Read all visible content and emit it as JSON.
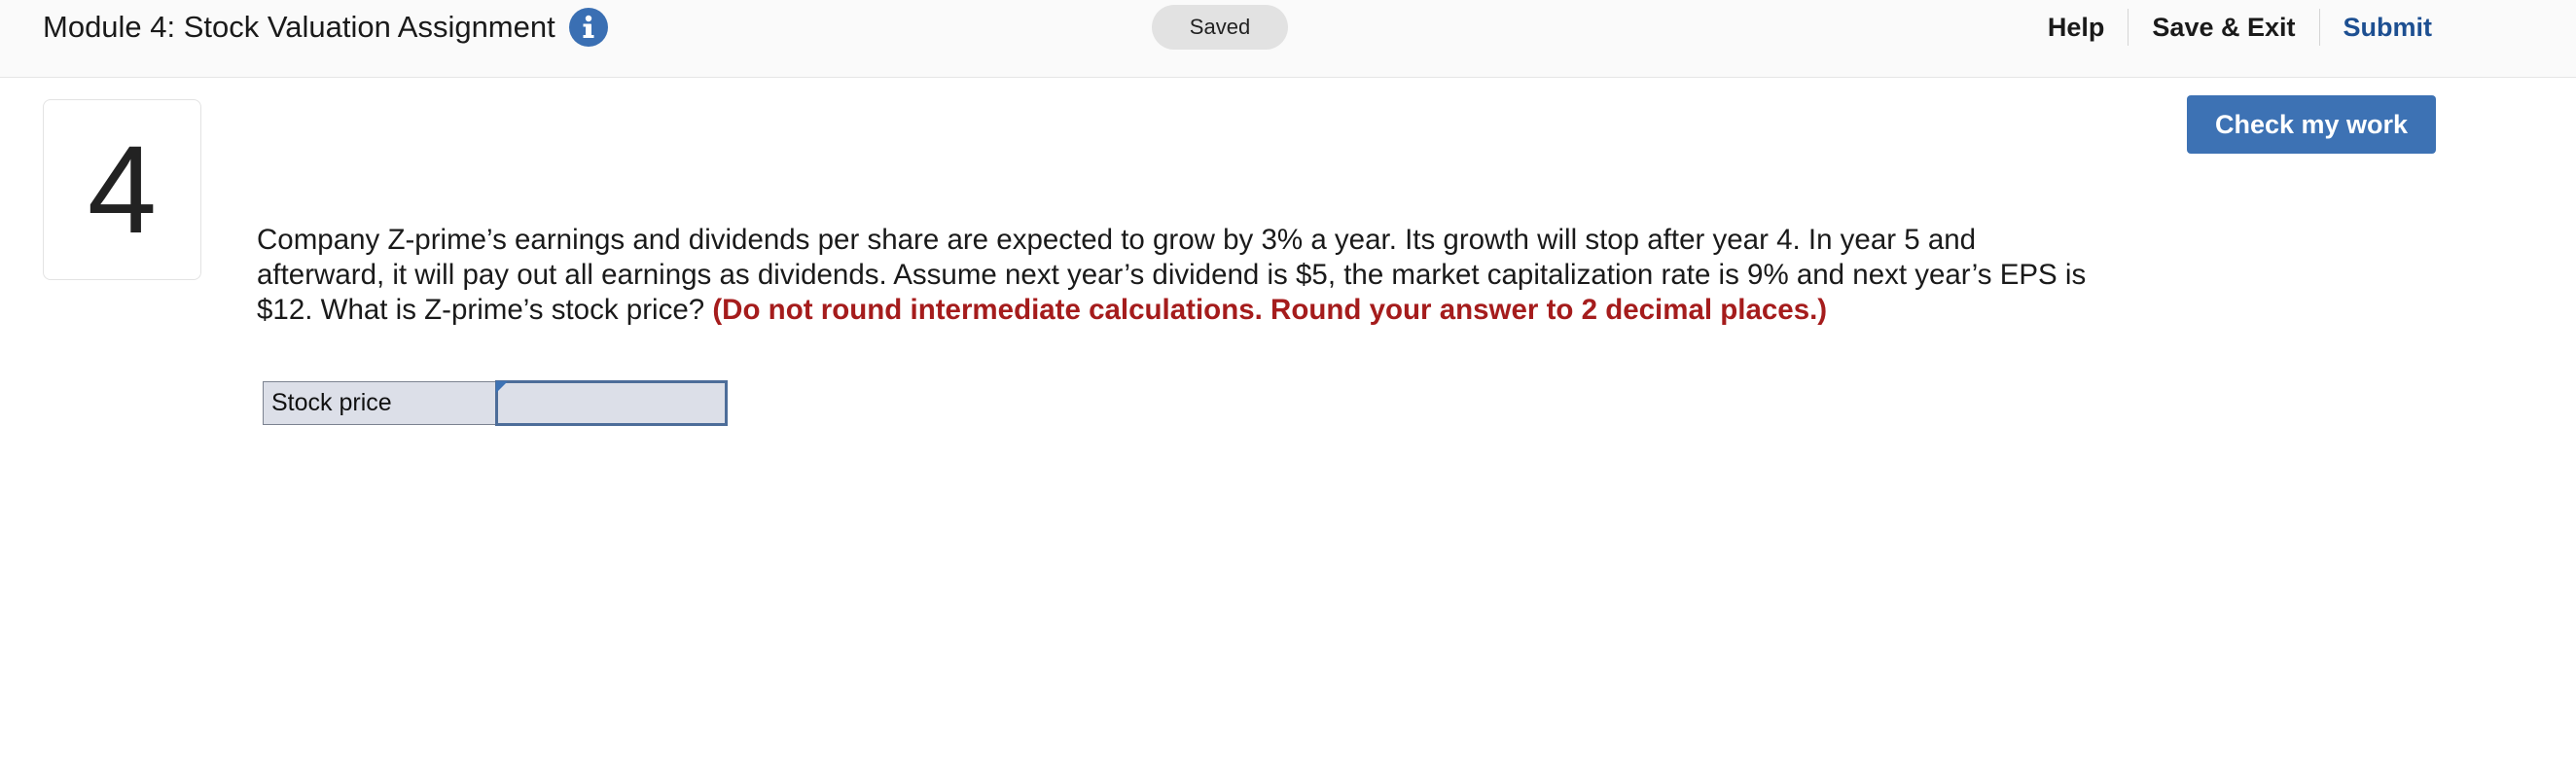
{
  "header": {
    "title": "Module 4: Stock Valuation Assignment",
    "info_icon": "info-icon",
    "saved_label": "Saved",
    "nav": {
      "help": "Help",
      "save_exit": "Save & Exit",
      "submit": "Submit"
    }
  },
  "question": {
    "number": "4",
    "check_button": "Check my work",
    "text": "Company Z-prime’s earnings and dividends per share are expected to grow by 3% a year. Its growth will stop after year 4. In year 5 and afterward, it will pay out all earnings as dividends. Assume next year’s dividend is $5, the market capitalization rate is 9% and next year’s EPS is $12. What is Z-prime’s stock price?",
    "instruction": "(Do not round intermediate calculations. Round your answer to 2 decimal places.)"
  },
  "answer": {
    "label": "Stock price",
    "value": ""
  },
  "colors": {
    "accent": "#3d72b4",
    "submit_text": "#1d4f91",
    "instruction_red": "#a51c1c"
  }
}
